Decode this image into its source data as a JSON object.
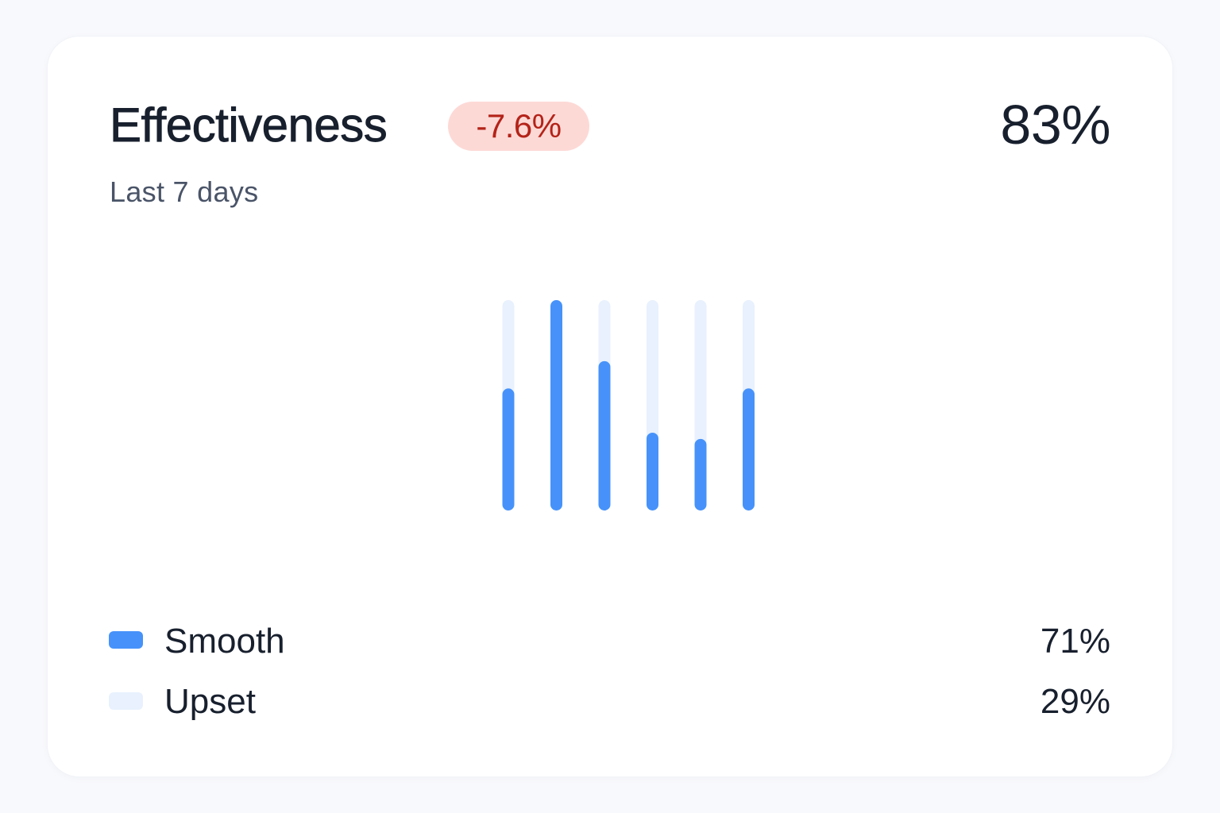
{
  "card": {
    "title": "Effectiveness",
    "change_badge": "-7.6%",
    "subtitle": "Last 7 days",
    "metric_value": "83%"
  },
  "colors": {
    "bar_fill": "#4692fa",
    "bar_track": "#e8f1fd",
    "badge_bg": "#fdd9d6",
    "badge_text": "#b42318",
    "title_text": "#18202e",
    "subtitle_text": "#4a5468"
  },
  "chart_data": {
    "type": "bar",
    "stacked": true,
    "categories": [
      "",
      "",
      "",
      "",
      "",
      ""
    ],
    "series": [
      {
        "name": "Smooth",
        "values": [
          0.58,
          1.0,
          0.71,
          0.37,
          0.34,
          0.58
        ]
      },
      {
        "name": "Upset",
        "values": [
          0.42,
          0.0,
          0.29,
          0.63,
          0.66,
          0.42
        ]
      }
    ],
    "ylim": [
      0,
      1
    ],
    "grid": false
  },
  "legend": {
    "items": [
      {
        "label": "Smooth",
        "value": "71%",
        "color": "#4692fa"
      },
      {
        "label": "Upset",
        "value": "29%",
        "color": "#e8f1fd"
      }
    ]
  }
}
